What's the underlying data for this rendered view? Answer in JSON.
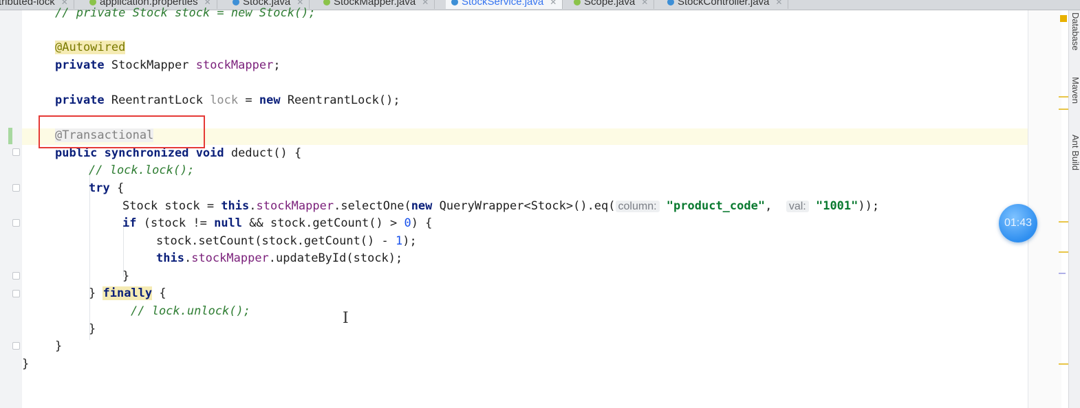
{
  "tabs": [
    {
      "label": "tributed-lock",
      "active": false
    },
    {
      "label": "application.properties",
      "active": false
    },
    {
      "label": "Stock.java",
      "active": false
    },
    {
      "label": "StockMapper.java",
      "active": false
    },
    {
      "label": "StockService.java",
      "active": true
    },
    {
      "label": "Scope.java",
      "active": false
    },
    {
      "label": "StockController.java",
      "active": false
    }
  ],
  "code": {
    "l1": "// private Stock stock = new Stock();",
    "autowired": "@Autowired",
    "l3_kw": "private",
    "l3_type": " StockMapper ",
    "l3_field": "stockMapper",
    "l3_end": ";",
    "l5_kw": "private",
    "l5_type": " ReentrantLock ",
    "l5_var": "lock",
    "l5_eq": " = ",
    "l5_new": "new",
    "l5_end": " ReentrantLock();",
    "transactional": "@Transactional",
    "l8_kw": "public synchronized void",
    "l8_end": " deduct() {",
    "l9": "// lock.lock();",
    "l10_kw": "try",
    "l10_end": " {",
    "l11_a": "Stock stock = ",
    "l11_this": "this",
    "l11_dot": ".",
    "l11_field": "stockMapper",
    "l11_b": ".selectOne(",
    "l11_new": "new",
    "l11_c": " QueryWrapper<Stock>().eq(",
    "l11_hint1": "column:",
    "l11_str1": "\"product_code\"",
    "l11_comma": ",  ",
    "l11_hint2": "val:",
    "l11_str2": "\"1001\"",
    "l11_end": "));",
    "l12_if": "if",
    "l12_a": " (stock != ",
    "l12_null": "null",
    "l12_b": " && stock.getCount() > ",
    "l12_zero": "0",
    "l12_c": ") {",
    "l13_a": "stock.setCount(stock.getCount() - ",
    "l13_one": "1",
    "l13_b": ");",
    "l14_this": "this",
    "l14_dot": ".",
    "l14_field": "stockMapper",
    "l14_b": ".updateById(stock);",
    "brace_close": "}",
    "l16_a": "} ",
    "l16_finally": "finally",
    "l16_b": " {",
    "l17": "// lock.unlock();",
    "class_close": "}"
  },
  "side_tools": [
    "Database",
    "Maven",
    "Ant Build"
  ],
  "timer": "01:43",
  "colors": {
    "highlight_box": "#e53935",
    "timer_bg": "#2f8ff0"
  }
}
